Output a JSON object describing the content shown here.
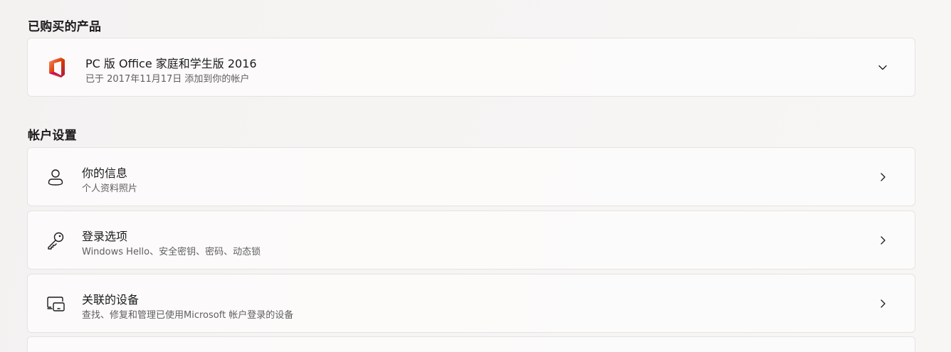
{
  "purchased": {
    "heading": "已购买的产品",
    "product": {
      "icon": "office-logo-icon",
      "title": "PC 版 Office 家庭和学生版 2016",
      "subtitle": "已于 2017年11月17日 添加到你的帐户",
      "expand_icon": "chevron-down-icon"
    }
  },
  "account_settings": {
    "heading": "帐户设置",
    "items": [
      {
        "icon": "person-icon",
        "title": "你的信息",
        "subtitle": "个人资料照片",
        "nav_icon": "chevron-right-icon"
      },
      {
        "icon": "key-icon",
        "title": "登录选项",
        "subtitle": "Windows Hello、安全密钥、密码、动态锁",
        "nav_icon": "chevron-right-icon"
      },
      {
        "icon": "linked-devices-icon",
        "title": "关联的设备",
        "subtitle": "查找、修复和管理已使用Microsoft 帐户登录的设备",
        "nav_icon": "chevron-right-icon"
      }
    ]
  },
  "colors": {
    "office_red": "#d83b01",
    "office_pink": "#e3008c",
    "text_primary": "#1b1b1b",
    "text_secondary": "#5f5f5f"
  }
}
